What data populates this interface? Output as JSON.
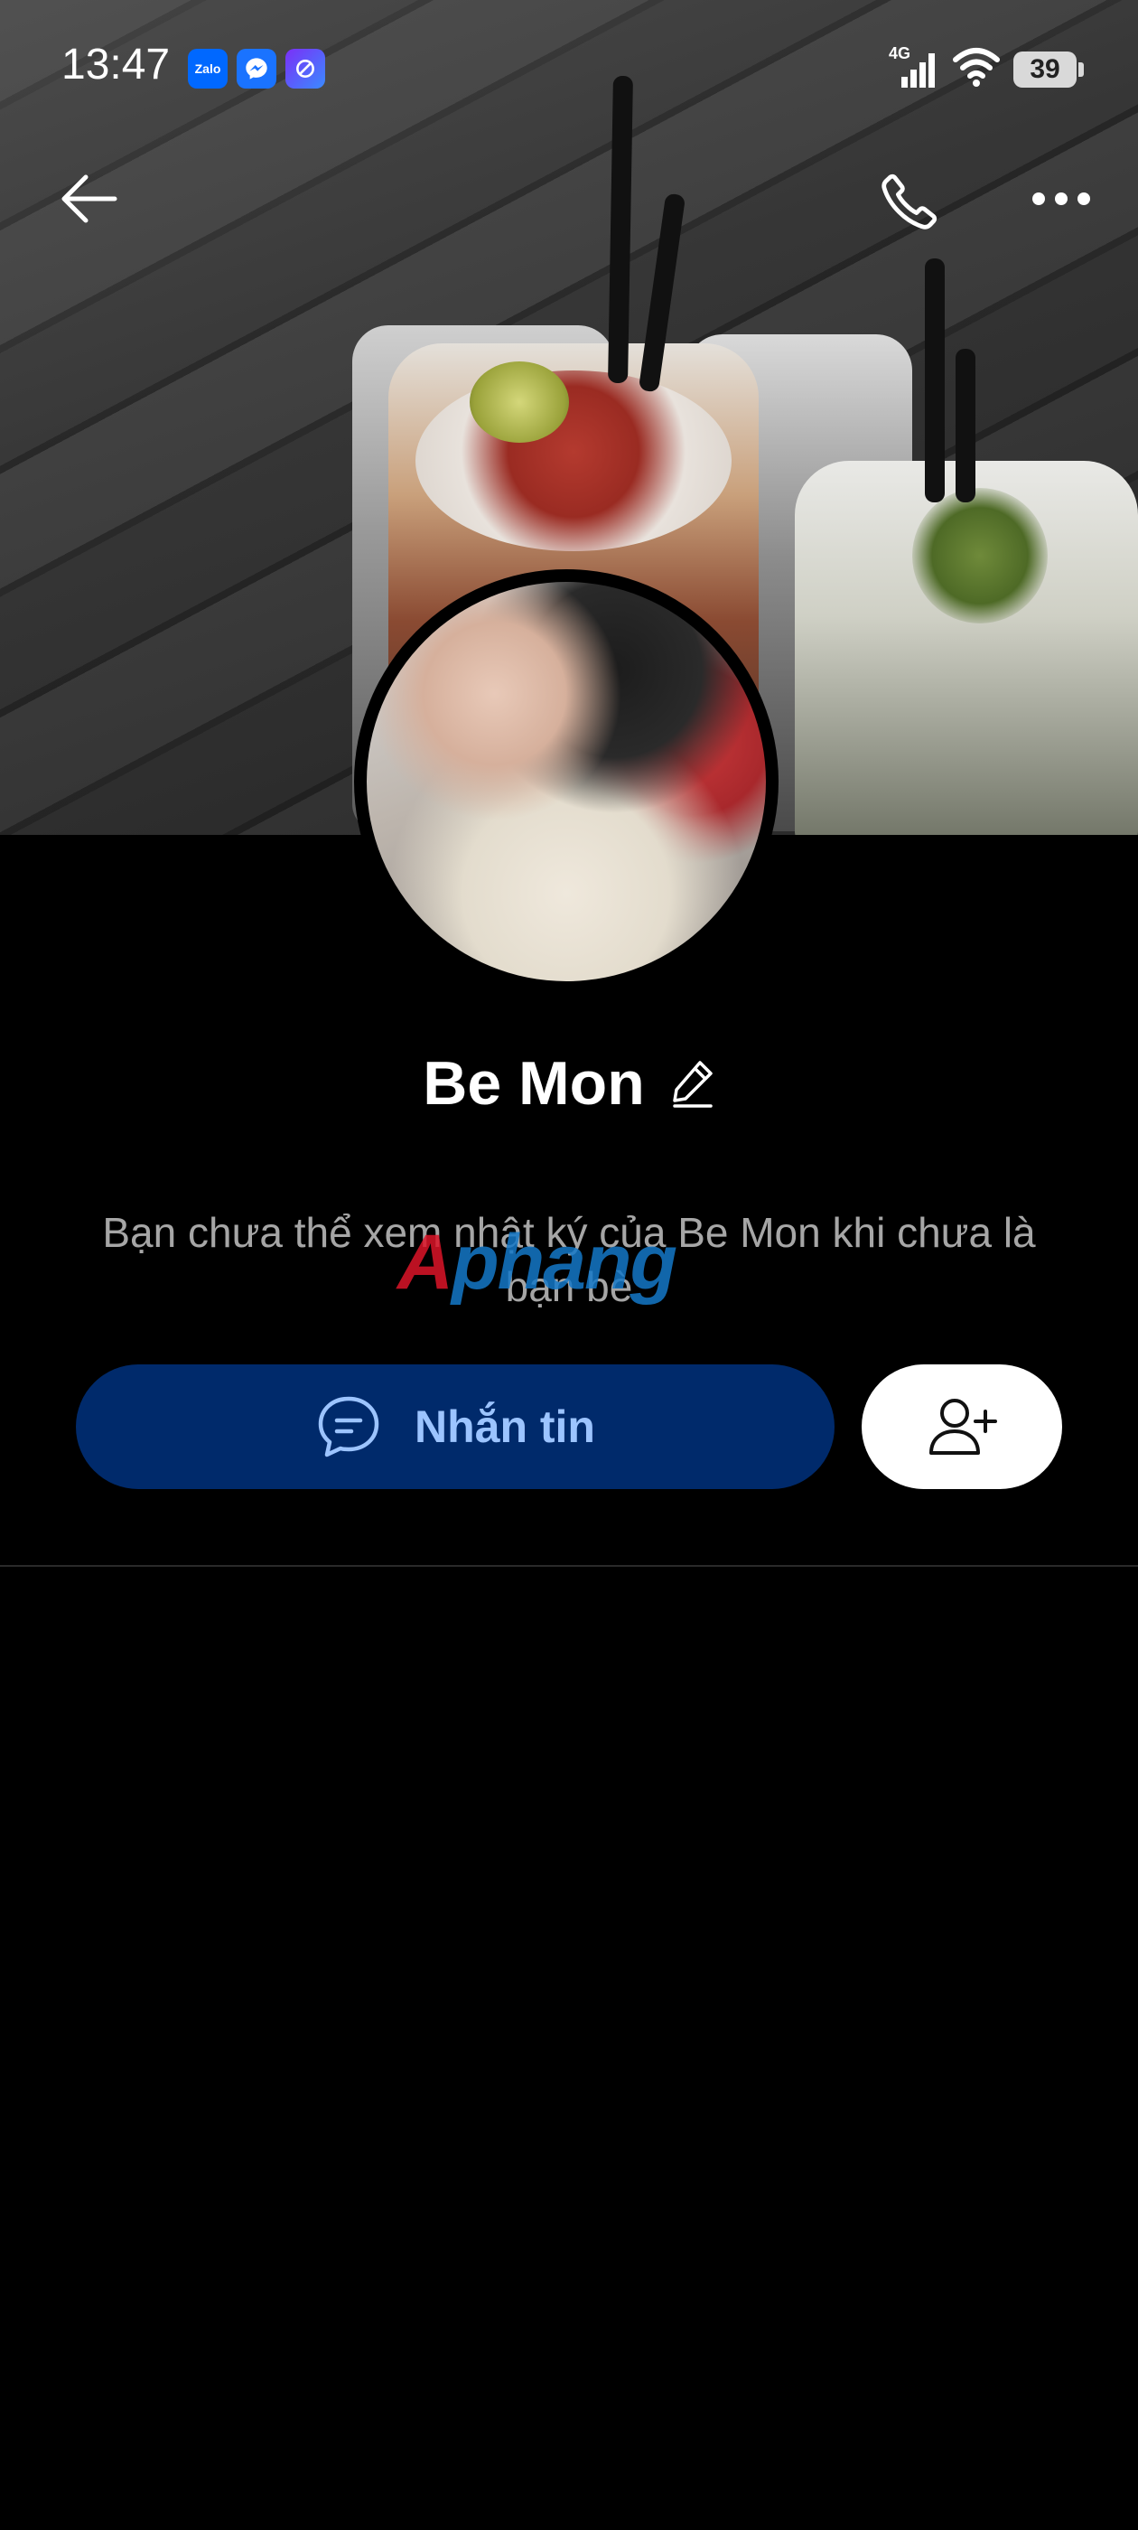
{
  "status_bar": {
    "time": "13:47",
    "apps": [
      {
        "name": "zalo",
        "label": "Zalo"
      },
      {
        "name": "messenger",
        "label": ""
      },
      {
        "name": "other",
        "label": ""
      }
    ],
    "network": "4G",
    "battery": "39"
  },
  "header": {
    "back_icon": "arrow-left-icon",
    "call_icon": "phone-icon",
    "more_icon": "more-horizontal-icon"
  },
  "profile": {
    "name": "Be Mon",
    "edit_icon": "pencil-icon",
    "info_line": "Bạn chưa thể xem nhật ký của Be Mon khi chưa là bạn bè",
    "watermark": {
      "part1": "A",
      "part2": "phang"
    }
  },
  "actions": {
    "message_label": "Nhắn tin",
    "message_icon": "chat-bubble-icon",
    "add_friend_icon": "user-plus-icon"
  },
  "colors": {
    "background": "#000000",
    "message_button_bg": "#002a6b",
    "message_button_text": "#9cc4ff",
    "info_text": "#a6a6a6"
  }
}
